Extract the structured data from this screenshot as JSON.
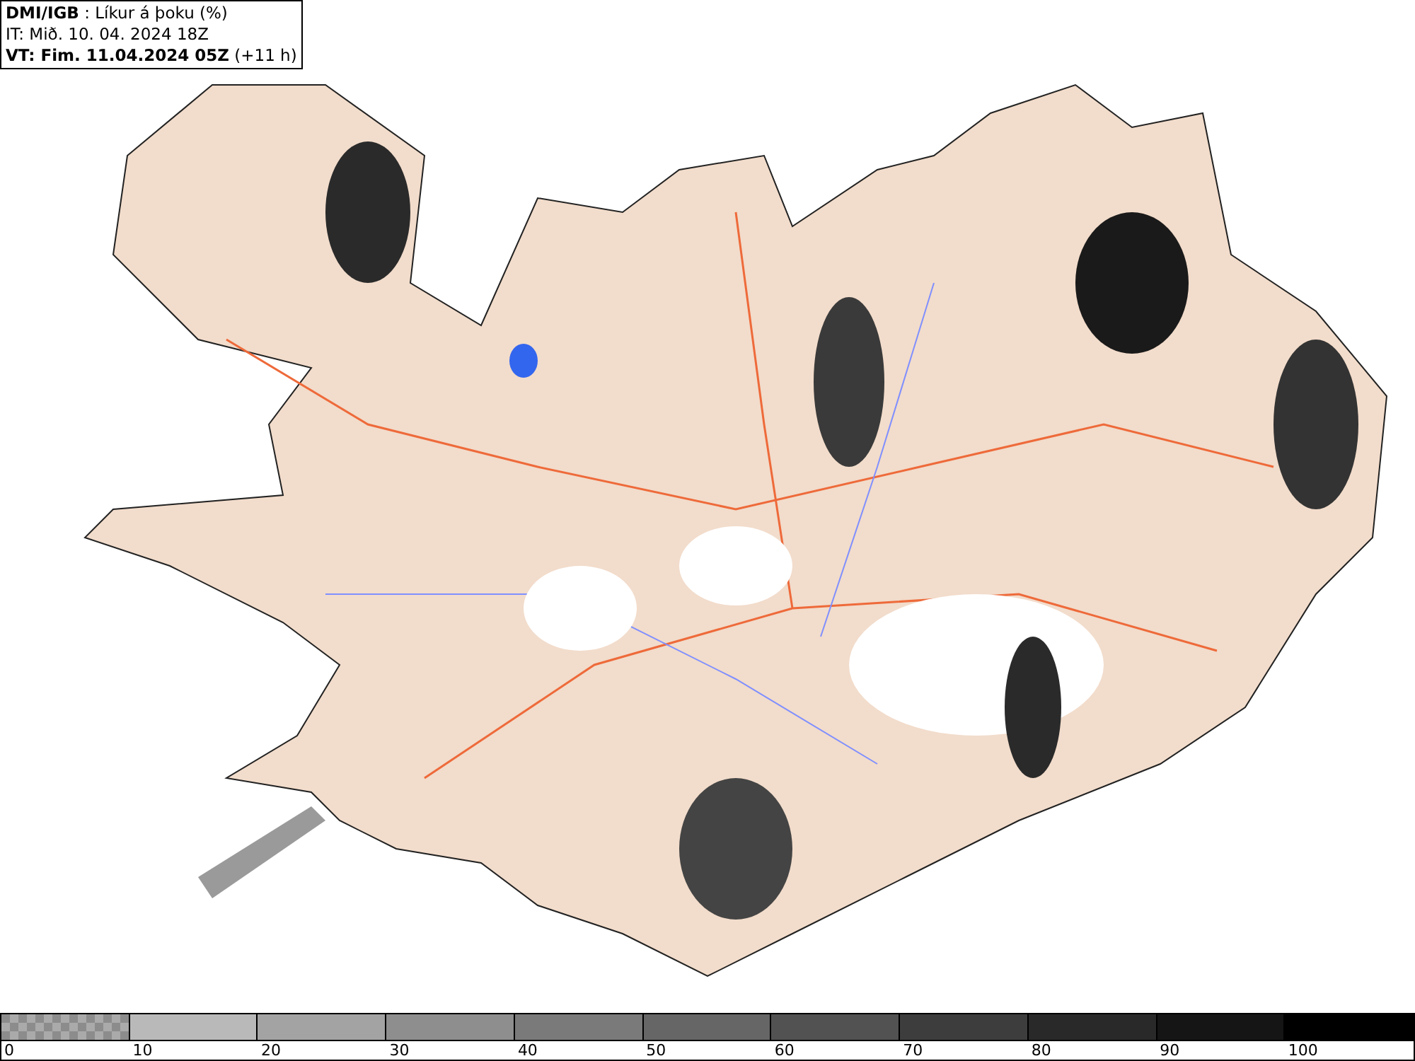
{
  "header": {
    "lines": [
      "**DMI/IGB** : Líkur á þoku (%)",
      "IT: Mið. 10. 04. 2024 18Z",
      "**VT: Fim. 11.04.2024 05Z** (+11 h)"
    ]
  },
  "legend": {
    "segments": [
      {
        "label": "0",
        "kind": "checker",
        "color": "#8c8c8c"
      },
      {
        "label": "10",
        "kind": "solid",
        "color": "#b9b9b9"
      },
      {
        "label": "20",
        "kind": "solid",
        "color": "#a3a3a3"
      },
      {
        "label": "30",
        "kind": "solid",
        "color": "#8e8e8e"
      },
      {
        "label": "40",
        "kind": "solid",
        "color": "#7a7a7a"
      },
      {
        "label": "50",
        "kind": "solid",
        "color": "#666666"
      },
      {
        "label": "60",
        "kind": "solid",
        "color": "#525252"
      },
      {
        "label": "70",
        "kind": "solid",
        "color": "#3d3d3d"
      },
      {
        "label": "80",
        "kind": "solid",
        "color": "#292929"
      },
      {
        "label": "90",
        "kind": "solid",
        "color": "#151515"
      },
      {
        "label": "100",
        "kind": "solid",
        "color": "#000000"
      }
    ]
  }
}
